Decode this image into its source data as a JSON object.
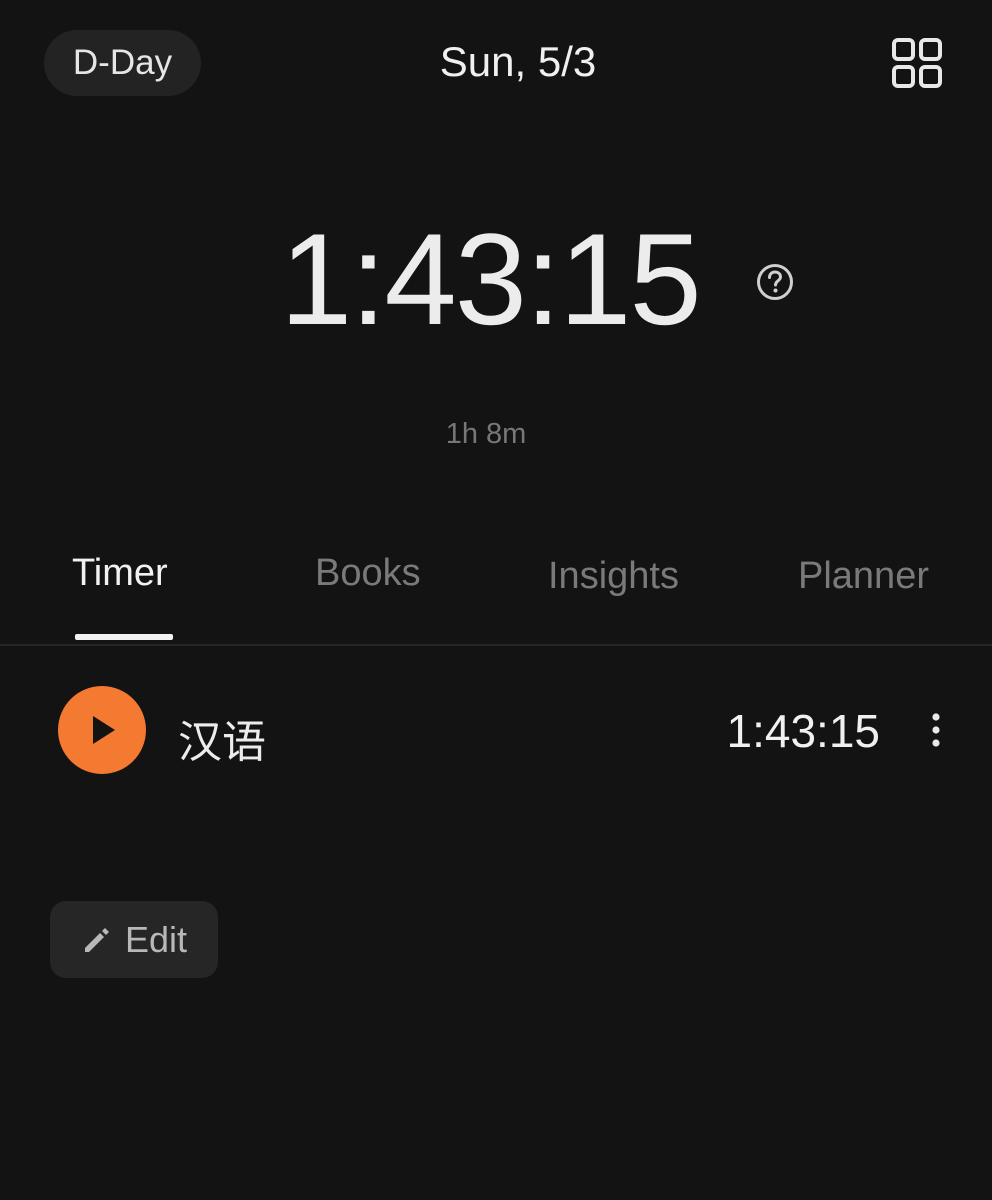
{
  "header": {
    "dday_label": "D-Day",
    "date": "Sun, 5/3",
    "grid_icon": "grid-icon"
  },
  "timer": {
    "total": "1:43:15",
    "help_icon": "help-circle-icon",
    "sub_duration": "1h 8m"
  },
  "tabs": [
    {
      "label": "Timer",
      "active": true
    },
    {
      "label": "Books",
      "active": false
    },
    {
      "label": "Insights",
      "active": false
    },
    {
      "label": "Planner",
      "active": false
    }
  ],
  "subject": {
    "name": "汉语",
    "time": "1:43:15",
    "play_icon": "play-icon",
    "more_icon": "more-vertical-icon"
  },
  "edit": {
    "label": "Edit",
    "icon": "pencil-icon"
  },
  "colors": {
    "background": "#131313",
    "accent": "#f47a32",
    "pill": "#232323"
  }
}
